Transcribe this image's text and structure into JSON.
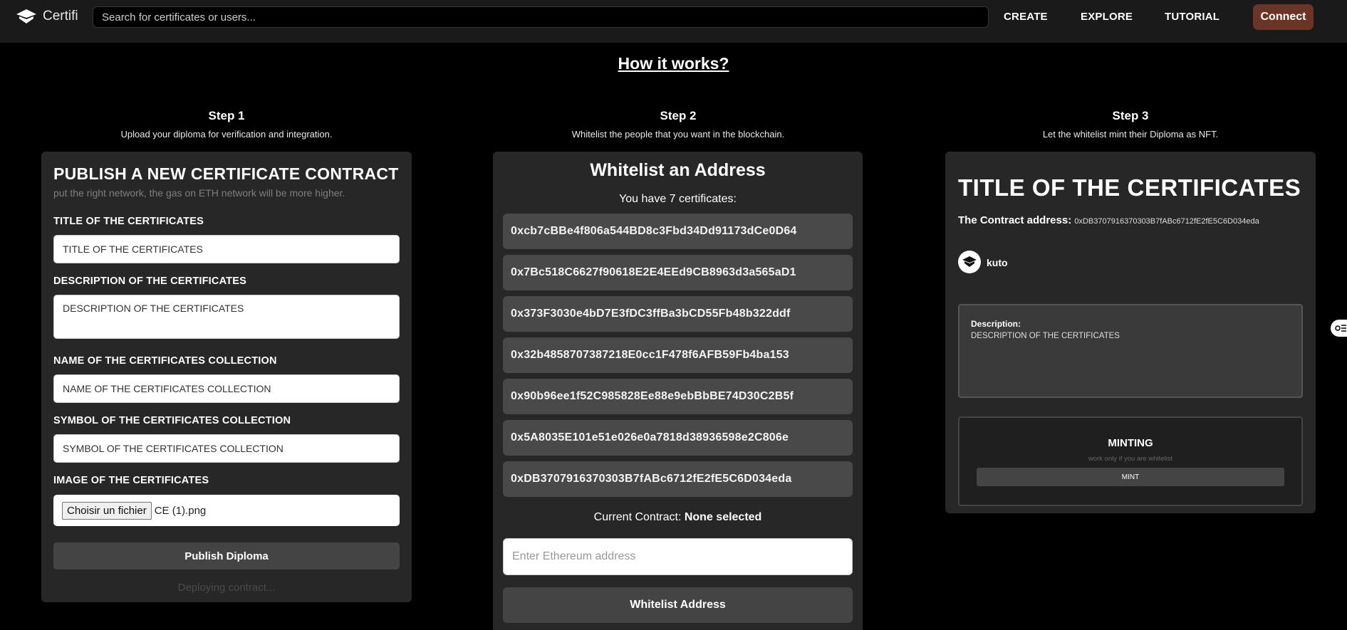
{
  "nav": {
    "logo_text": "Certifi",
    "search_placeholder": "Search for certificates or users...",
    "links": [
      "CREATE",
      "EXPLORE",
      "TUTORIAL"
    ],
    "connect_label": "Connect",
    "connect_color": "#6b3424"
  },
  "how_it_works": "How it works?",
  "steps": [
    {
      "title": "Step 1",
      "desc": "Upload your diploma for verification and integration."
    },
    {
      "title": "Step 2",
      "desc": "Whitelist the people that you want in the blockchain."
    },
    {
      "title": "Step 3",
      "desc": "Let the whitelist mint their Diploma as NFT."
    }
  ],
  "publish": {
    "title": "PUBLISH A NEW CERTIFICATE CONTRACT",
    "subtitle": "put the right network, the gas on ETH network will be more higher.",
    "fields": [
      {
        "label": "TITLE OF THE CERTIFICATES",
        "value": "TITLE OF THE CERTIFICATES"
      },
      {
        "label": "DESCRIPTION OF THE CERTIFICATES",
        "value": "DESCRIPTION OF THE CERTIFICATES"
      },
      {
        "label": "NAME OF THE CERTIFICATES COLLECTION",
        "value": "NAME OF THE CERTIFICATES COLLECTION"
      },
      {
        "label": "SYMBOL OF THE CERTIFICATES COLLECTION",
        "value": "SYMBOL OF THE CERTIFICATES COLLECTION"
      }
    ],
    "image_label": "IMAGE OF THE CERTIFICATES",
    "file_button": "Choisir un fichier",
    "file_name": "CE (1).png",
    "button": "Publish Diploma",
    "status": "Deploying contract..."
  },
  "whitelist": {
    "title": "Whitelist an Address",
    "count_text": "You have 7 certificates:",
    "addresses": [
      "0xcb7cBBe4f806a544BD8c3Fbd34Dd91173dCe0D64",
      "0x7Bc518C6627f90618E2E4EEd9CB8963d3a565aD1",
      "0x373F3030e4bD7E3fDC3ffBa3bCD55Fb48b322ddf",
      "0x32b4858707387218E0cc1F478f6AFB59Fb4ba153",
      "0x90b96ee1f52C985828Ee88e9ebBbBE74D30C2B5f",
      "0x5A8035E101e51e026e0a7818d38936598e2C806e",
      "0xDB3707916370303B7fABc6712fE2fE5C6D034eda"
    ],
    "current_label": "Current Contract:",
    "current_value": "None selected",
    "input_placeholder": "Enter Ethereum address",
    "button": "Whitelist Address"
  },
  "certificate": {
    "title": "TITLE OF THE CERTIFICATES",
    "contract_label": "The Contract address:",
    "contract_address": "0xDB3707916370303B7fABc6712fE2fE5C6D034eda",
    "username": "kuto",
    "description_label": "Description:",
    "description_value": "DESCRIPTION OF THE CERTIFICATES",
    "minting_title": "MINTING",
    "minting_sub": "work only if you are whitelist",
    "mint_button": "MINT"
  }
}
